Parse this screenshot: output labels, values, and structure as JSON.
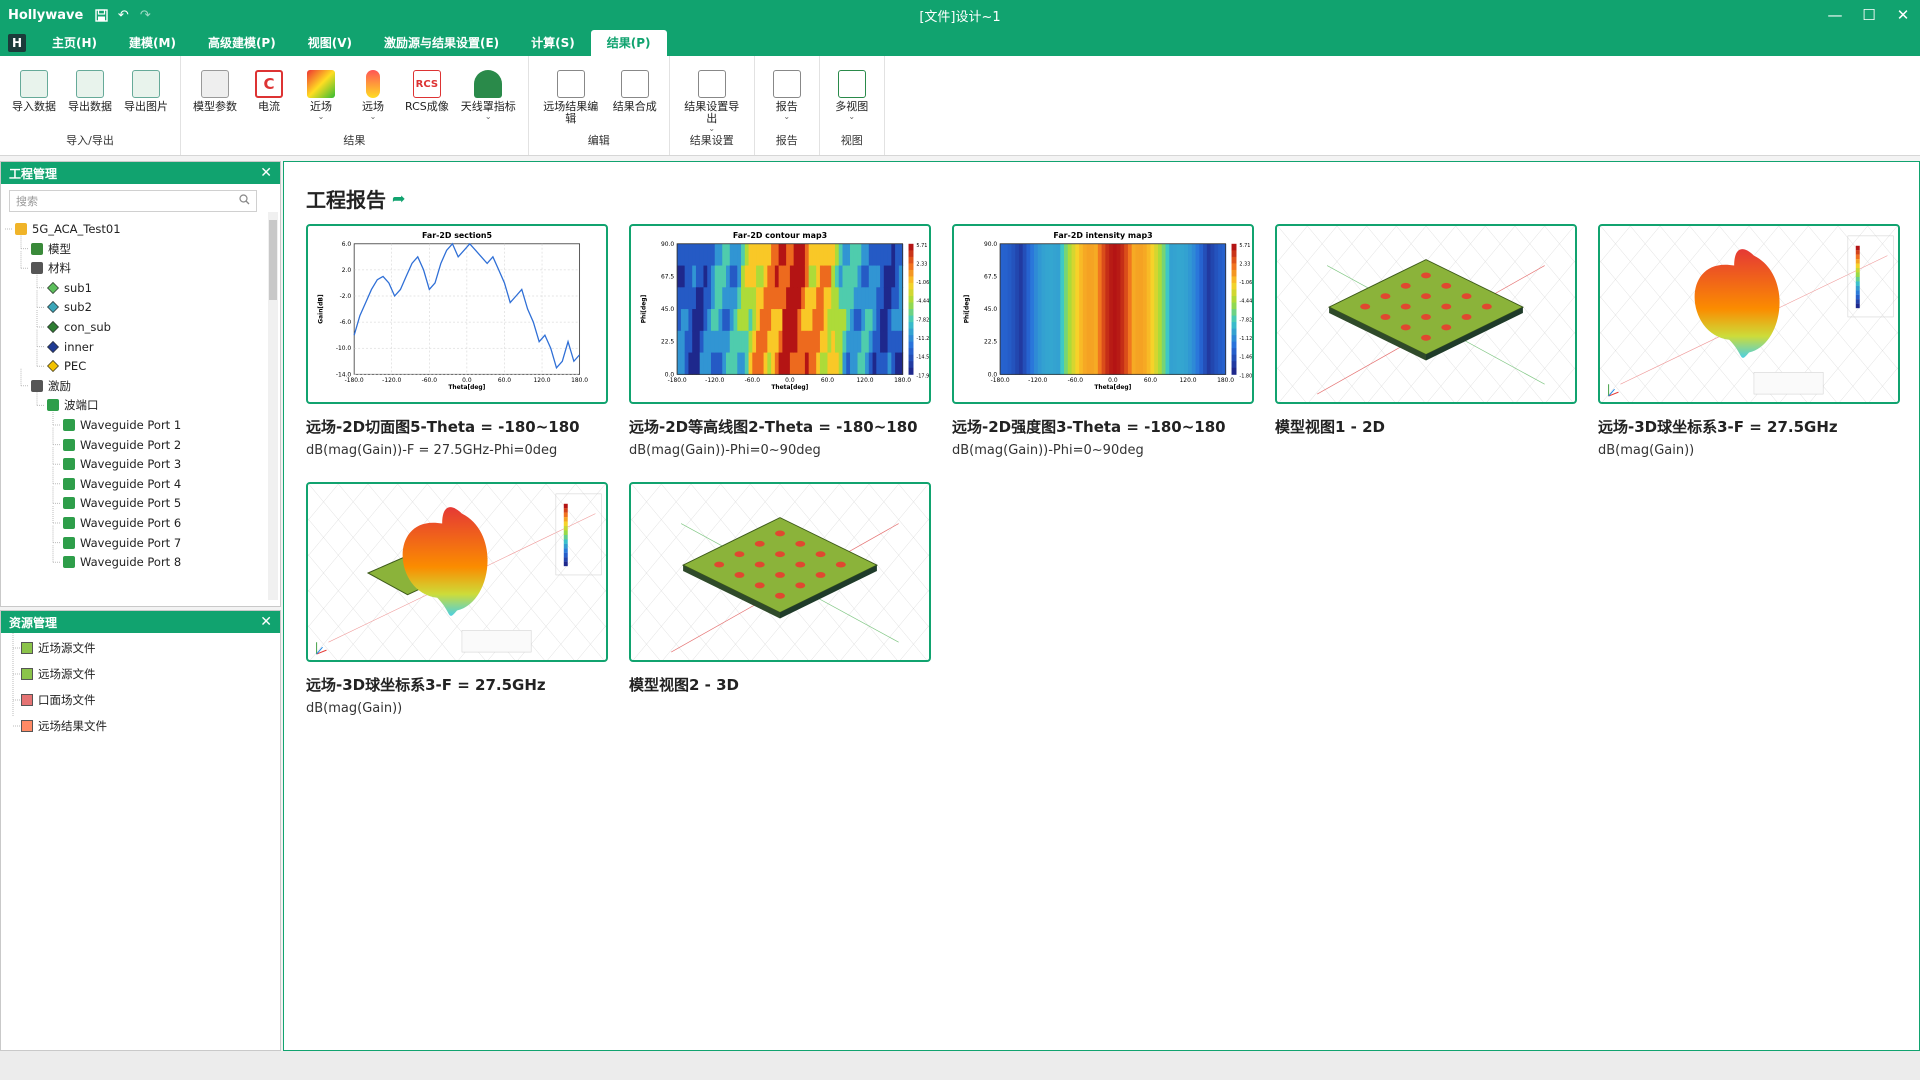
{
  "titlebar": {
    "app_name": "Hollywave",
    "doc_title": "[文件]设计~1"
  },
  "menu": {
    "logo": "H",
    "tabs": [
      "主页(H)",
      "建模(M)",
      "高级建模(P)",
      "视图(V)",
      "激励源与结果设置(E)",
      "计算(S)",
      "结果(P)"
    ],
    "active_index": 6
  },
  "ribbon": {
    "groups": [
      {
        "label": "导入/导出",
        "buttons": [
          {
            "label": "导入数据",
            "icon": "import-data-icon"
          },
          {
            "label": "导出数据",
            "icon": "export-data-icon"
          },
          {
            "label": "导出图片",
            "icon": "export-image-icon"
          }
        ]
      },
      {
        "label": "结果",
        "buttons": [
          {
            "label": "模型参数",
            "icon": "model-params-icon"
          },
          {
            "label": "电流",
            "icon": "current-icon",
            "glyph": "C"
          },
          {
            "label": "近场",
            "icon": "near-field-icon",
            "dropdown": true
          },
          {
            "label": "远场",
            "icon": "far-field-icon",
            "dropdown": true
          },
          {
            "label": "RCS成像",
            "icon": "rcs-imaging-icon",
            "glyph": "RCS"
          },
          {
            "label": "天线罩指标",
            "icon": "radome-metrics-icon",
            "dropdown": true
          }
        ]
      },
      {
        "label": "编辑",
        "buttons": [
          {
            "label": "远场结果编辑",
            "icon": "far-field-edit-icon"
          },
          {
            "label": "结果合成",
            "icon": "result-combine-icon"
          }
        ]
      },
      {
        "label": "结果设置",
        "buttons": [
          {
            "label": "结果设置导出",
            "icon": "result-settings-export-icon",
            "dropdown": true
          }
        ]
      },
      {
        "label": "报告",
        "buttons": [
          {
            "label": "报告",
            "icon": "report-icon",
            "dropdown": true
          }
        ]
      },
      {
        "label": "视图",
        "buttons": [
          {
            "label": "多视图",
            "icon": "multi-view-icon",
            "dropdown": true
          }
        ]
      }
    ]
  },
  "project_panel": {
    "title": "工程管理",
    "search_placeholder": "搜索",
    "tree": [
      {
        "label": "5G_ACA_Test01",
        "depth": 0,
        "icon": "folder"
      },
      {
        "label": "模型",
        "depth": 1,
        "icon": "cube"
      },
      {
        "label": "材料",
        "depth": 1,
        "icon": "layers"
      },
      {
        "label": "sub1",
        "depth": 2,
        "icon": "diamond-green"
      },
      {
        "label": "sub2",
        "depth": 2,
        "icon": "diamond-teal"
      },
      {
        "label": "con_sub",
        "depth": 2,
        "icon": "diamond-darkgreen"
      },
      {
        "label": "inner",
        "depth": 2,
        "icon": "diamond-navy"
      },
      {
        "label": "PEC",
        "depth": 2,
        "icon": "diamond-yellow"
      },
      {
        "label": "激励",
        "depth": 1,
        "icon": "excitation"
      },
      {
        "label": "波端口",
        "depth": 2,
        "icon": "port"
      },
      {
        "label": "Waveguide Port 1",
        "depth": 3,
        "icon": "port"
      },
      {
        "label": "Waveguide Port 2",
        "depth": 3,
        "icon": "port"
      },
      {
        "label": "Waveguide Port 3",
        "depth": 3,
        "icon": "port"
      },
      {
        "label": "Waveguide Port 4",
        "depth": 3,
        "icon": "port"
      },
      {
        "label": "Waveguide Port 5",
        "depth": 3,
        "icon": "port"
      },
      {
        "label": "Waveguide Port 6",
        "depth": 3,
        "icon": "port"
      },
      {
        "label": "Waveguide Port 7",
        "depth": 3,
        "icon": "port"
      },
      {
        "label": "Waveguide Port 8",
        "depth": 3,
        "icon": "port"
      }
    ]
  },
  "resource_panel": {
    "title": "资源管理",
    "items": [
      "近场源文件",
      "远场源文件",
      "口面场文件",
      "远场结果文件"
    ]
  },
  "main": {
    "title": "工程报告",
    "cards": [
      {
        "title": "远场-2D切面图5-Theta = -180~180",
        "subtitle": "dB(mag(Gain))-F = 27.5GHz-Phi=0deg",
        "thumb": "line",
        "thumb_title": "Far-2D section5",
        "x_label": "Theta[deg]",
        "y_label": "Gain[dB]",
        "y_ticks": [
          "6.0",
          "2.0",
          "-2.0",
          "-6.0",
          "-10.0",
          "-14.0"
        ],
        "x_ticks": [
          "-180.0",
          "-120.0",
          "-60.0",
          "0.0",
          "60.0",
          "120.0",
          "180.0"
        ]
      },
      {
        "title": "远场-2D等高线图2-Theta = -180~180",
        "subtitle": "dB(mag(Gain))-Phi=0~90deg",
        "thumb": "contour",
        "thumb_title": "Far-2D contour map3",
        "x_label": "Theta[deg]",
        "y_label": "Phi[deg]",
        "y_ticks": [
          "90.0",
          "67.5",
          "45.0",
          "22.5",
          "0.0"
        ],
        "x_ticks": [
          "-180.0",
          "-120.0",
          "-60.0",
          "0.0",
          "60.0",
          "120.0",
          "180.0"
        ],
        "cbar": [
          "5.71",
          "2.33",
          "-1.06",
          "-4.44",
          "-7.82",
          "-11.21",
          "-14.59",
          "-17.98"
        ]
      },
      {
        "title": "远场-2D强度图3-Theta = -180~180",
        "subtitle": "dB(mag(Gain))-Phi=0~90deg",
        "thumb": "intensity",
        "thumb_title": "Far-2D intensity map3",
        "x_label": "Theta[deg]",
        "y_label": "Phi[deg]",
        "y_ticks": [
          "90.0",
          "67.5",
          "45.0",
          "22.5",
          "0.0"
        ],
        "x_ticks": [
          "-180.0",
          "-120.0",
          "-60.0",
          "0.0",
          "60.0",
          "120.0",
          "180.0"
        ],
        "cbar": [
          "5.71",
          "2.33",
          "-1.06",
          "-4.44",
          "-7.82",
          "-1.12e1",
          "-1.46e1",
          "-1.80e1"
        ]
      },
      {
        "title": "模型视图1 - 2D",
        "subtitle": "",
        "thumb": "model"
      },
      {
        "title": "远场-3D球坐标系3-F = 27.5GHz",
        "subtitle": "dB(mag(Gain))",
        "thumb": "pattern3d"
      },
      {
        "title": "远场-3D球坐标系3-F = 27.5GHz",
        "subtitle": "dB(mag(Gain))",
        "thumb": "pattern3d-model"
      },
      {
        "title": "模型视图2 - 3D",
        "subtitle": "",
        "thumb": "model"
      }
    ]
  },
  "colors": {
    "accent": "#11a36f",
    "tree_line": "#9a9a9a"
  }
}
